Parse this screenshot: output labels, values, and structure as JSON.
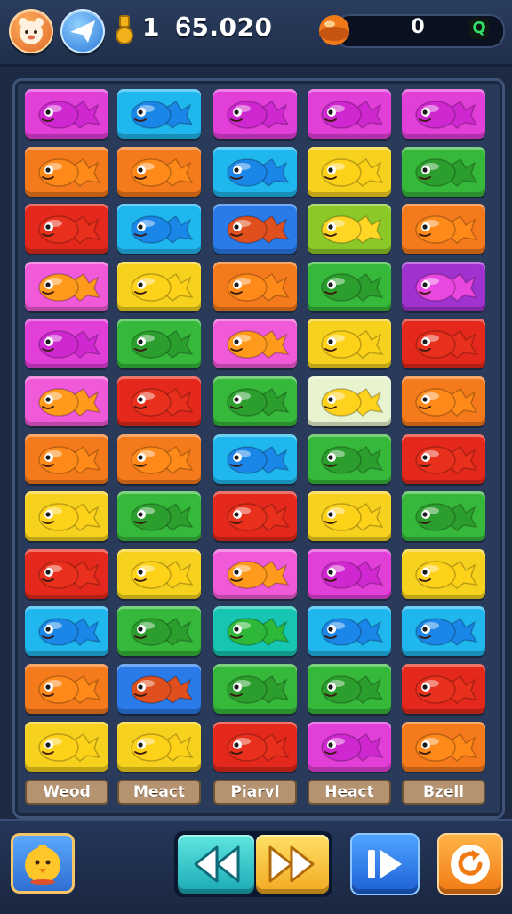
{
  "hud": {
    "level": "1",
    "coins": "Ꮾ5.020",
    "score": "0",
    "goal_icon_text": "Q",
    "icons": [
      "avatar-icon",
      "paper-plane-icon",
      "medal-icon",
      "orb-icon"
    ]
  },
  "board": {
    "columns": 5,
    "rows": 12,
    "column_labels": [
      "Weod",
      "Meact",
      "Piarvl",
      "Heact",
      "Bzell"
    ],
    "tiles": [
      [
        "magenta",
        "cyan",
        "magenta",
        "magenta",
        "magenta"
      ],
      [
        "orange",
        "orange",
        "cyan",
        "yellow",
        "green"
      ],
      [
        "red",
        "cyan",
        "blue",
        "lime",
        "orange"
      ],
      [
        "pink",
        "yellow",
        "orange",
        "green",
        "purple"
      ],
      [
        "magenta",
        "green",
        "pink",
        "yellow",
        "red"
      ],
      [
        "pink",
        "red",
        "green",
        "cream",
        "orange"
      ],
      [
        "orange",
        "orange",
        "cyan",
        "green",
        "red"
      ],
      [
        "yellow",
        "green",
        "red",
        "yellow",
        "green"
      ],
      [
        "red",
        "yellow",
        "pink",
        "magenta",
        "yellow"
      ],
      [
        "cyan",
        "green",
        "teal",
        "cyan",
        "cyan"
      ],
      [
        "orange",
        "blue",
        "green",
        "green",
        "red"
      ],
      [
        "yellow",
        "yellow",
        "red",
        "magenta",
        "orange"
      ]
    ],
    "tile_colors": {
      "magenta": "#e23fd9",
      "cyan": "#1fb7ee",
      "orange": "#f57a1c",
      "yellow": "#f6d21e",
      "green": "#36b83a",
      "red": "#e4291c",
      "blue": "#2a7ae8",
      "lime": "#8cc828",
      "pink": "#f05ad8",
      "purple": "#a032d0",
      "cream": "#e8f4d0",
      "teal": "#17c6b2"
    },
    "fish_colors": {
      "magenta": "#d028d0",
      "cyan": "#1a86e8",
      "orange": "#ff8a1a",
      "yellow": "#ffd21a",
      "green": "#2c9e2e",
      "red": "#e8301c",
      "blue": "#e0501e",
      "lime": "#ffd624",
      "pink": "#ff9a1c",
      "purple": "#ea46e0",
      "cream": "#ffd21e",
      "teal": "#2eb83a"
    }
  },
  "controls": {
    "items": [
      "chick-button",
      "rewind-button",
      "fast-forward-button",
      "step-button",
      "reload-button"
    ]
  },
  "colors": {
    "background": "#1c2a44",
    "board": "#2a3a5a",
    "label_plate": "#b59270"
  }
}
